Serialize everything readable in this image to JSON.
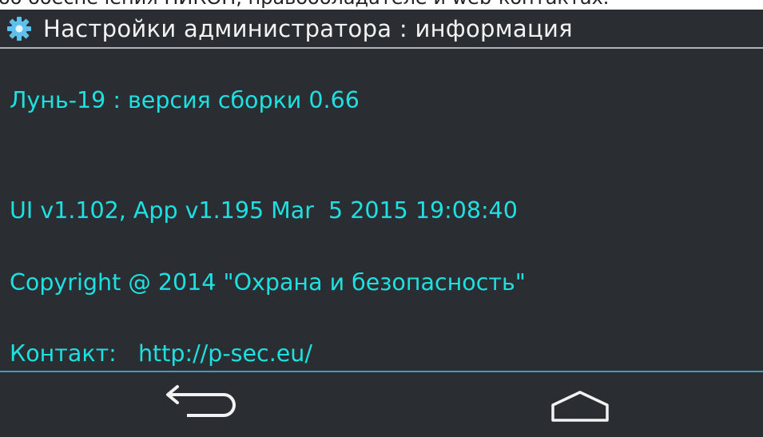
{
  "caption": {
    "text": "об обеспечения НИКОН, правообладателе и web-контактах."
  },
  "header": {
    "title": "Настройки администратора : информация",
    "icon": "gear-icon",
    "icon_color": "#5fc0ec"
  },
  "info": {
    "build": "Лунь-19 : версия сборки 0.66",
    "versions": "UI v1.102, App v1.195 Mar  5 2015 19:08:40",
    "copyright": "Copyright @ 2014 \"Охрана и безопасность\"",
    "contact": "Контакт:   http://p-sec.eu/"
  },
  "nav": {
    "back_icon": "back-arrow-icon",
    "home_icon": "home-icon"
  },
  "colors": {
    "background": "#2a2e32",
    "text_accent": "#1ee0e0",
    "title_text": "#f2f2f2",
    "divider": "#3a9ec2"
  }
}
